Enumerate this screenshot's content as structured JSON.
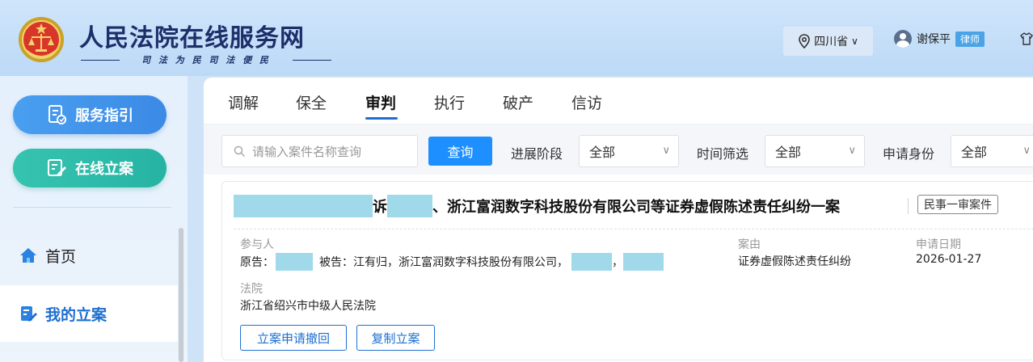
{
  "header": {
    "title": "人民法院在线服务网",
    "slogan": "司 法 为 民   司 法 便 民",
    "province": "四川省",
    "user_name": "谢保平",
    "user_role": "律师"
  },
  "sidebar": {
    "guide_label": "服务指引",
    "file_label": "在线立案",
    "nav": [
      {
        "label": "首页"
      },
      {
        "label": "我的立案"
      }
    ]
  },
  "tabs": [
    {
      "label": "调解"
    },
    {
      "label": "保全"
    },
    {
      "label": "审判",
      "active": true
    },
    {
      "label": "执行"
    },
    {
      "label": "破产"
    },
    {
      "label": "信访"
    }
  ],
  "filters": {
    "search_placeholder": "请输入案件名称查询",
    "query_label": "查询",
    "stage_label": "进展阶段",
    "stage_value": "全部",
    "time_label": "时间筛选",
    "time_value": "全部",
    "identity_label": "申请身份",
    "identity_value": "全部"
  },
  "case": {
    "title_part1": "诉",
    "title_part2": "、浙江富润数字科技股份有限公司等证券虚假陈述责任纠纷一案",
    "tag": "民事一审案件",
    "participants_label": "参与人",
    "plaintiff_prefix": "原告：",
    "defendant_prefix": "被告：江有归，浙江富润数字科技股份有限公司，",
    "comma": "，",
    "cause_label": "案由",
    "cause_value": "证券虚假陈述责任纠纷",
    "date_label": "申请日期",
    "date_value": "2026-01-27",
    "court_label": "法院",
    "court_value": "浙江省绍兴市中级人民法院",
    "withdraw_label": "立案申请撤回",
    "copy_label": "复制立案"
  }
}
